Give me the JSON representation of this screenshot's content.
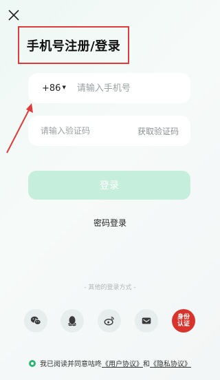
{
  "header": {
    "title": "手机号注册/登录",
    "close_icon": "close-icon"
  },
  "phone": {
    "country_code": "+86",
    "placeholder": "请输入手机号",
    "value": ""
  },
  "code": {
    "placeholder": "请输入验证码",
    "value": "",
    "get_code_label": "获取验证码"
  },
  "login_button": {
    "label": "登录"
  },
  "password_login": {
    "label": "密码登录"
  },
  "other_methods": {
    "label": "- 其他的登录方式 -",
    "items": [
      {
        "icon": "wechat-icon"
      },
      {
        "icon": "qq-icon"
      },
      {
        "icon": "weibo-icon"
      },
      {
        "icon": "mail-icon"
      },
      {
        "icon": "identity-icon",
        "label_line1": "身份",
        "label_line2": "认证"
      }
    ]
  },
  "agreement": {
    "prefix": "我已阅读并同意咕咚",
    "user_agreement": "《用户协议》",
    "and": "和",
    "privacy_agreement": "《隐私协议》"
  },
  "colors": {
    "accent": "#2bb673",
    "login_button_bg": "#c5eedc",
    "highlight_border": "#e03a3a",
    "identity_red": "#d8342d"
  }
}
